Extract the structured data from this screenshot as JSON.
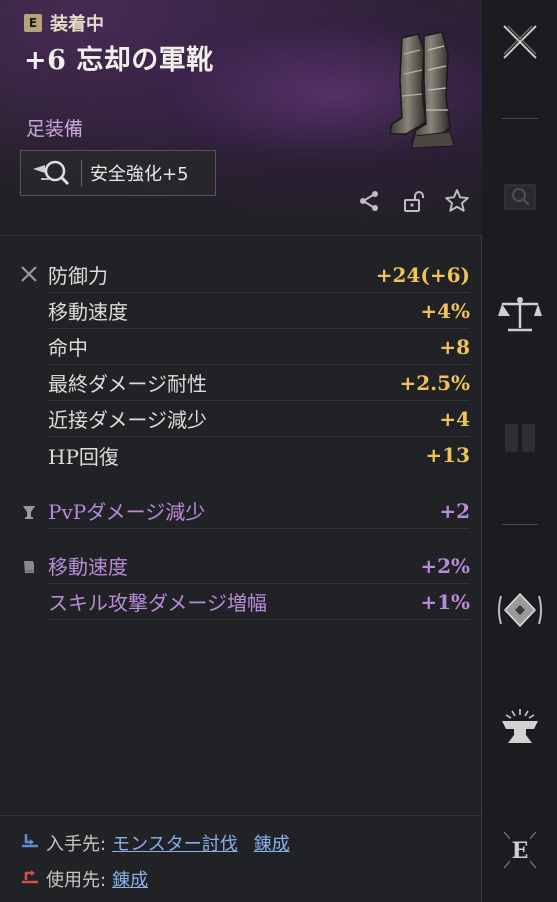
{
  "header": {
    "equip_badge": "E",
    "equip_status": "装着中",
    "item_name": "+6 忘却の軍靴",
    "item_type": "足装備",
    "enhance_label": "安全強化+5"
  },
  "stats": [
    {
      "label": "防御力",
      "value": "+24(+6)"
    },
    {
      "label": "移動速度",
      "value": "+4%"
    },
    {
      "label": "命中",
      "value": "+8"
    },
    {
      "label": "最終ダメージ耐性",
      "value": "+2.5%"
    },
    {
      "label": "近接ダメージ減少",
      "value": "+4"
    },
    {
      "label": "HP回復",
      "value": "+13"
    }
  ],
  "pvp": {
    "label": "PvPダメージ減少",
    "value": "+2"
  },
  "set_bonus": [
    {
      "label": "移動速度",
      "value": "+2%"
    },
    {
      "label": "スキル攻撃ダメージ増幅",
      "value": "+1%"
    }
  ],
  "footer": {
    "acquire_label": "入手先:",
    "acquire_links": [
      "モンスター討伐",
      "錬成"
    ],
    "use_label": "使用先:",
    "use_links": [
      "錬成"
    ]
  },
  "colors": {
    "stat_value": "#f0c25a",
    "pvp": "#b98ad6",
    "link": "#8ab0e8",
    "item_type": "#c9a7dc"
  },
  "icons": {
    "side": [
      "close-icon",
      "search-icon",
      "compare-scale-icon",
      "book-icon",
      "enchant-rune-icon",
      "anvil-icon",
      "unequip-e-icon"
    ],
    "actions": [
      "share-icon",
      "unlock-icon",
      "star-icon"
    ]
  }
}
